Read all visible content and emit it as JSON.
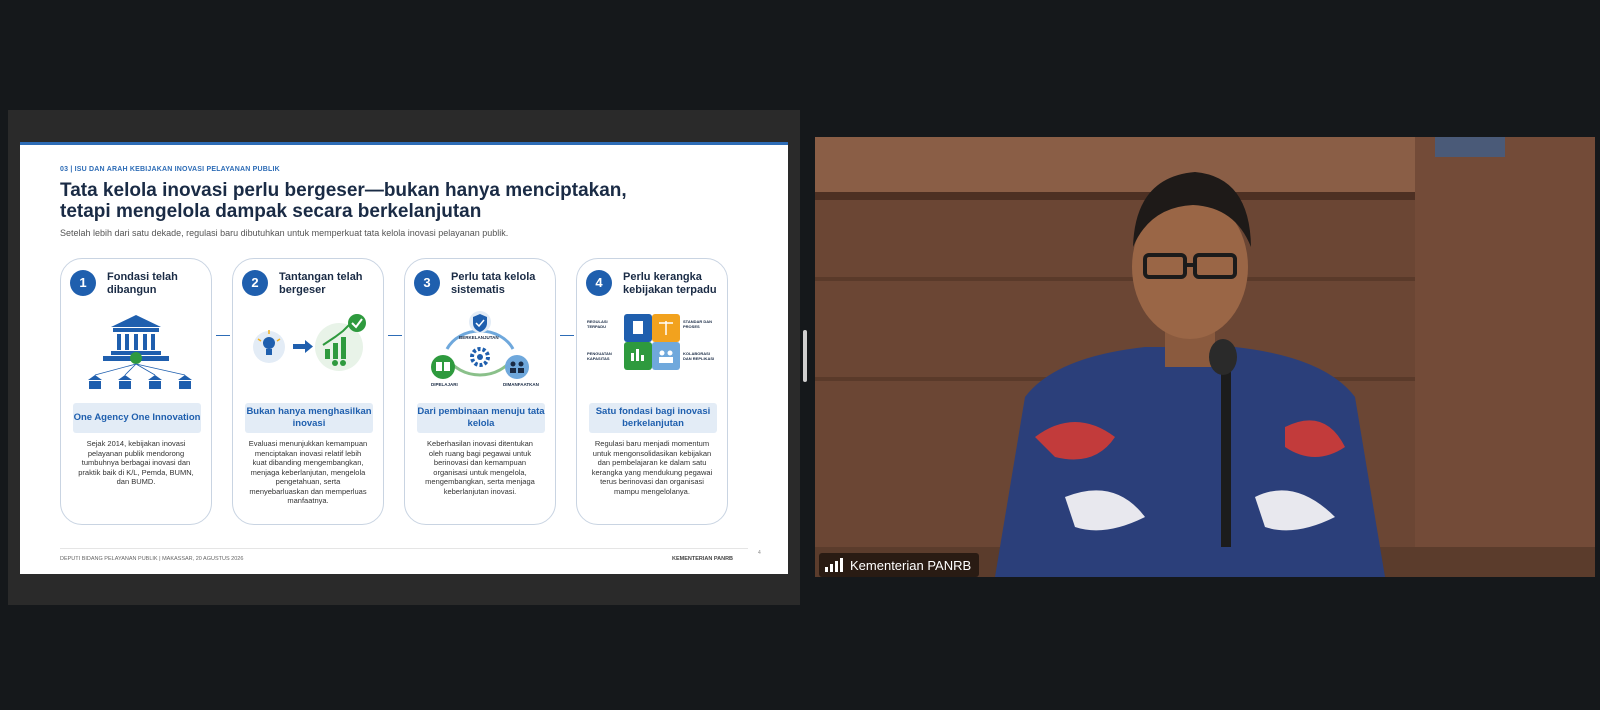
{
  "slide": {
    "section_label": "03 | ISU DAN ARAH KEBIJAKAN INOVASI PELAYANAN PUBLIK",
    "title": "Tata kelola inovasi perlu bergeser—bukan hanya menciptakan, tetapi mengelola dampak secara berkelanjutan",
    "subtitle": "Setelah lebih dari satu dekade, regulasi baru dibutuhkan untuk memperkuat tata kelola inovasi pelayanan publik.",
    "cards": [
      {
        "number": "1",
        "title": "Fondasi telah dibangun",
        "label": "One Agency One Innovation",
        "description": "Sejak 2014, kebijakan inovasi pelayanan publik mendorong tumbuhnya berbagai inovasi dan praktik baik di K/L, Pemda, BUMN, dan BUMD."
      },
      {
        "number": "2",
        "title": "Tantangan telah bergeser",
        "label": "Bukan hanya menghasilkan inovasi",
        "description": "Evaluasi menunjukkan kemampuan menciptakan inovasi relatif lebih kuat dibanding mengembangkan, menjaga keberlanjutan, mengelola pengetahuan, serta menyebarluaskan dan memperluas manfaatnya."
      },
      {
        "number": "3",
        "title": "Perlu tata kelola sistematis",
        "label": "Dari pembinaan menuju tata kelola",
        "description": "Keberhasilan inovasi ditentukan oleh ruang bagi pegawai untuk berinovasi dan kemampuan organisasi untuk mengelola, mengembangkan, serta menjaga keberlanjutan inovasi.",
        "diagram": {
          "top": "BERKELANJUTAN",
          "left": "DIPELAJARI",
          "right": "DIMANFAATKAN"
        }
      },
      {
        "number": "4",
        "title": "Perlu kerangka kebijakan terpadu",
        "label": "Satu fondasi bagi inovasi berkelanjutan",
        "description": "Regulasi baru menjadi momentum untuk mengonsolidasikan kebijakan dan pembelajaran ke dalam satu kerangka yang mendukung pegawai terus berinovasi dan organisasi mampu mengelolanya.",
        "puzzle": {
          "tl": "REGULASI TERPADU",
          "tr": "STANDAR DAN PROSES",
          "bl": "PENGUATAN KAPASITAS",
          "br": "KOLABORASI DAN REPLIKASI"
        }
      }
    ],
    "footer_left": "DEPUTI BIDANG PELAYANAN PUBLIK | MAKASSAR, 20 AGUSTUS 2026",
    "footer_right": "KEMENTERIAN PANRB",
    "page_number": "4"
  },
  "video": {
    "participant_label": "Kementerian PANRB"
  },
  "colors": {
    "accent": "#1f5fae",
    "label_bg": "#e3ecf6",
    "green": "#2e9a3e",
    "background": "#15181b"
  },
  "icons": [
    "building-icon",
    "lightbulb-icon",
    "arrow-right-icon",
    "chart-up-icon",
    "check-icon",
    "shield-icon",
    "gear-icon",
    "book-icon",
    "people-icon",
    "puzzle-icon",
    "signal-bars-icon"
  ]
}
